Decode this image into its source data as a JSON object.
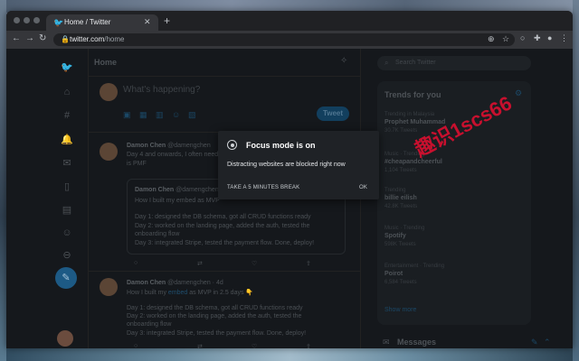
{
  "browser": {
    "tab_title": "Home / Twitter",
    "url_host": "twitter.com",
    "url_path": "/home"
  },
  "twitter": {
    "feed_title": "Home",
    "compose_prompt": "What's happening?",
    "tweet_button": "Tweet",
    "tweet1": {
      "author": "Damon Chen",
      "handle": "@damengchen",
      "line1": "Day 4 and onwards, I often need",
      "line2": "is PMF"
    },
    "quote": {
      "author": "Damon Chen",
      "handle": "@damengchen",
      "headline": "How I built my embed as MVP",
      "line1": "Day 1: designed the DB schema, got all CRUD functions ready",
      "line2": "Day 2: worked on the landing page, added the auth, tested the",
      "line3": "onboarding flow",
      "line4": "Day 3: integrated Stripe, tested the payment flow. Done, deploy!"
    },
    "tweet2": {
      "author": "Damon Chen",
      "handle": "@damengchen",
      "time": "4d",
      "line0a": "How I built my",
      "line0b": "embed",
      "line0c": "as MVP in 2.5 days",
      "line1": "Day 1: designed the DB schema, got all CRUD functions ready",
      "line2": "Day 2: worked on the landing page, added the auth, tested the",
      "line3": "onboarding flow",
      "line4": "Day 3: integrated Stripe, tested the payment flow. Done, deploy!"
    },
    "search_placeholder": "Search Twitter",
    "trends_title": "Trends for you",
    "trends": [
      {
        "meta": "Trending in Malaysia",
        "name": "Prophet Muhammad",
        "count": "30.7K Tweets"
      },
      {
        "meta": "Music · Trending",
        "name": "#cheapandcheerful",
        "count": "1,104 Tweets"
      },
      {
        "meta": "Trending",
        "name": "billie eilish",
        "count": "42.8K Tweets"
      },
      {
        "meta": "Music · Trending",
        "name": "Spotify",
        "count": "598K Tweets"
      },
      {
        "meta": "Entertainment · Trending",
        "name": "Poirot",
        "count": "6,584 Tweets"
      }
    ],
    "show_more": "Show more",
    "messages_title": "Messages"
  },
  "watermark": "趣识1scs66",
  "focus_modal": {
    "title": "Focus mode is on",
    "body": "Distracting websites are blocked right now",
    "break_button": "TAKE A 5 MINUTES BREAK",
    "ok_button": "OK"
  },
  "colors": {
    "accent": "#1d9bf0",
    "modal_bg": "#1f2226",
    "watermark": "#c8102e"
  }
}
